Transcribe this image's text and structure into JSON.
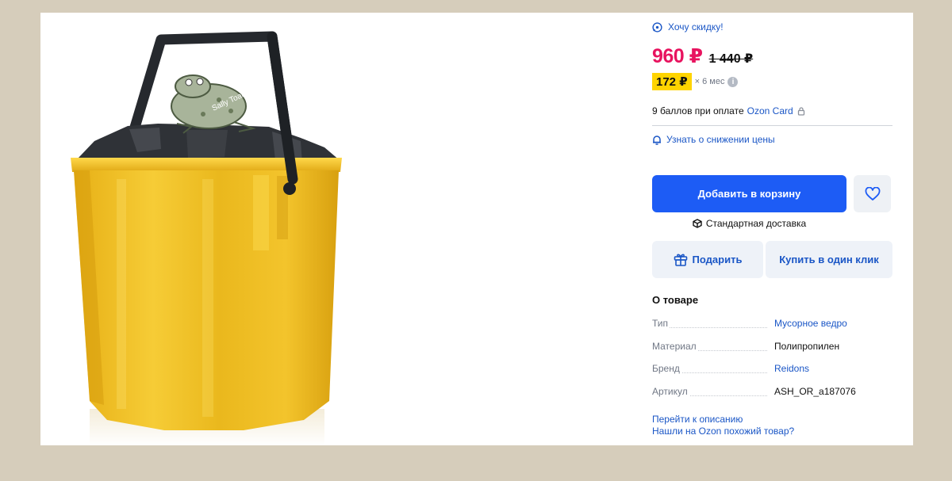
{
  "promo": {
    "discount_label": "Хочу скидку!"
  },
  "price": {
    "current": "960 ₽",
    "old": "1 440 ₽"
  },
  "installment": {
    "amount": "172 ₽",
    "term": "× 6 мес",
    "info": "i"
  },
  "bonus": {
    "text": "9 баллов при оплате",
    "card": "Ozon Card"
  },
  "price_alert": {
    "label": "Узнать о снижении цены"
  },
  "actions": {
    "add_to_cart": "Добавить в корзину",
    "delivery": "Стандартная доставка",
    "gift": "Подарить",
    "one_click": "Купить в один клик"
  },
  "about": {
    "title": "О товаре",
    "specs": [
      {
        "key": "Тип",
        "value": "Мусорное ведро"
      },
      {
        "key": "Материал",
        "value": "Полипропилен"
      },
      {
        "key": "Бренд",
        "value": "Reidons"
      },
      {
        "key": "Артикул",
        "value": "ASH_OR_a187076"
      }
    ]
  },
  "links": {
    "description": "Перейти к описанию",
    "similar": "Нашли на Ozon похожий товар?"
  },
  "product_image": {
    "sticker_text": "Sally Toad"
  },
  "colors": {
    "brand_blue": "#1d5cf5",
    "price_pink": "#e8135f",
    "installment_yellow": "#ffd400",
    "bucket_yellow": "#f0bf22"
  }
}
